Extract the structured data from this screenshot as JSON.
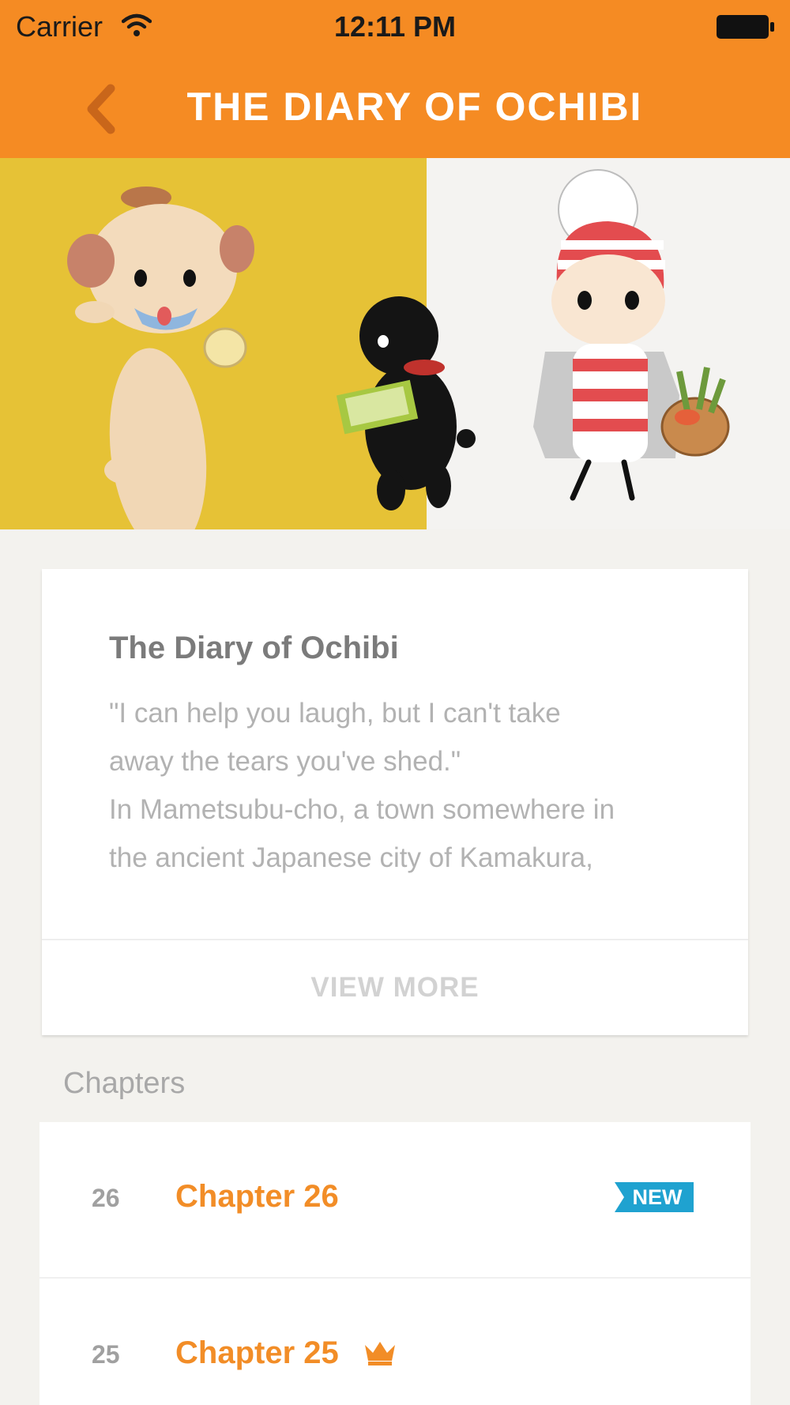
{
  "status_bar": {
    "carrier": "Carrier",
    "time": "12:11 PM"
  },
  "nav": {
    "title": "THE DIARY OF OCHIBI",
    "back_icon": "chevron-left-icon"
  },
  "colors": {
    "header": "#f58b23",
    "accent": "#f28d27",
    "badge": "#1fa2d0",
    "background": "#f3f2ee"
  },
  "description": {
    "title": "The Diary of Ochibi",
    "lines": [
      "\"I can help you laugh, but I can't take",
      "away the tears you've shed.\"",
      "In Mametsubu-cho, a town somewhere in",
      "the ancient Japanese city of Kamakura,"
    ],
    "view_more": "VIEW MORE"
  },
  "chapters": {
    "label": "Chapters",
    "items": [
      {
        "number": "26",
        "title": "Chapter 26",
        "badge": "NEW"
      },
      {
        "number": "25",
        "title": "Chapter 25",
        "icon": "crown-icon"
      }
    ]
  }
}
